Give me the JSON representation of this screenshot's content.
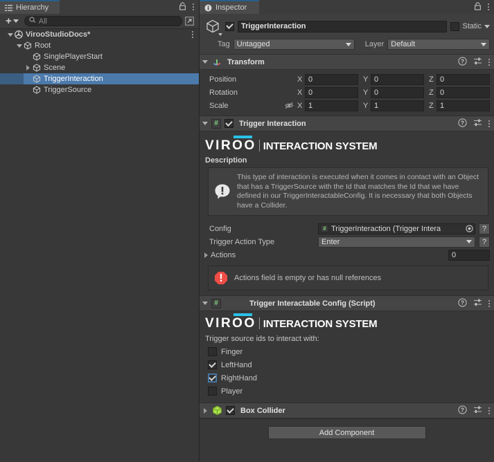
{
  "hierarchy": {
    "tab_label": "Hierarchy",
    "tab_icon": "hierarchy-list-icon",
    "lock_icon": "lock-icon",
    "menu_icon": "kebab-menu-icon",
    "toolbar": {
      "add_label": "+",
      "add_icon": "plus-icon",
      "dropdown_icon": "chevron-down-icon",
      "search_icon": "search-icon",
      "search_placeholder": "All",
      "search_value": "",
      "expand_icon": "open-in-new-icon"
    },
    "items": [
      {
        "label": "VirooStudioDocs*",
        "depth": 0,
        "foldout": "open",
        "icon": "unity-scene-icon",
        "selected": false,
        "bold": true,
        "kebab": true
      },
      {
        "label": "Root",
        "depth": 1,
        "foldout": "open",
        "icon": "gameobject-cube-icon",
        "selected": false,
        "bold": false,
        "kebab": false
      },
      {
        "label": "SinglePlayerStart",
        "depth": 2,
        "foldout": "none",
        "icon": "gameobject-cube-icon",
        "selected": false,
        "bold": false,
        "kebab": false
      },
      {
        "label": "Scene",
        "depth": 2,
        "foldout": "closed",
        "icon": "gameobject-cube-icon",
        "selected": false,
        "bold": false,
        "kebab": false
      },
      {
        "label": "TriggerInteraction",
        "depth": 2,
        "foldout": "none",
        "icon": "gameobject-cube-icon",
        "selected": true,
        "bold": false,
        "kebab": false
      },
      {
        "label": "TriggerSource",
        "depth": 2,
        "foldout": "none",
        "icon": "gameobject-cube-icon",
        "selected": false,
        "bold": false,
        "kebab": false
      }
    ]
  },
  "inspector": {
    "tab_label": "Inspector",
    "tab_icon": "info-circle-icon",
    "lock_icon": "lock-icon",
    "menu_icon": "kebab-menu-icon",
    "gameobject": {
      "icon": "gameobject-cube-icon",
      "enabled": true,
      "name": "TriggerInteraction",
      "static_label": "Static",
      "static_checked": false,
      "tag_label": "Tag",
      "tag_value": "Untagged",
      "layer_label": "Layer",
      "layer_value": "Default"
    },
    "components": [
      {
        "id": "transform",
        "title": "Transform",
        "icon": "transform-axis-icon",
        "expanded": true,
        "has_checkbox": false,
        "help_icon": "help-circle-icon",
        "preset_icon": "preset-sliders-icon",
        "menu_icon": "kebab-menu-icon",
        "rows": [
          {
            "label": "Position",
            "x": "0",
            "y": "0",
            "z": "0",
            "eye_off": false
          },
          {
            "label": "Rotation",
            "x": "0",
            "y": "0",
            "z": "0",
            "eye_off": false
          },
          {
            "label": "Scale",
            "x": "1",
            "y": "1",
            "z": "1",
            "eye_off": true,
            "eye_icon": "eye-off-icon"
          }
        ],
        "axis_labels": {
          "x": "X",
          "y": "Y",
          "z": "Z"
        }
      },
      {
        "id": "trigger-interaction",
        "title": "Trigger Interaction",
        "icon": "script-hash-icon",
        "expanded": true,
        "has_checkbox": true,
        "checked": true,
        "help_icon": "help-circle-icon",
        "preset_icon": "preset-sliders-icon",
        "menu_icon": "kebab-menu-icon",
        "brand": {
          "word": "VIROO",
          "tagline": "INTERACTION SYSTEM",
          "accent_color": "#29c2e8"
        },
        "description_label": "Description",
        "description_icon": "exclamation-bubble-icon",
        "description_text": "This type of interaction is executed when it comes in contact with an Object that has a TriggerSource with the Id that matches the Id that we have defined in our TriggerInteractableConfig. It is necessary that both Objects have a Collider.",
        "config_label": "Config",
        "config_value": "TriggerInteraction (Trigger Intera",
        "config_object_icon": "script-hash-icon",
        "config_picker_icon": "object-picker-icon",
        "config_help": "?",
        "action_type_label": "Trigger Action Type",
        "action_type_value": "Enter",
        "action_type_help": "?",
        "actions_label": "Actions",
        "actions_foldout": "closed",
        "actions_count": "0",
        "error_icon": "error-octagon-icon",
        "error_text": "Actions field is empty or has null references",
        "error_color": "#e8514a"
      },
      {
        "id": "trigger-interactable-config",
        "title": "Trigger Interactable Config (Script)",
        "icon": "script-hash-icon",
        "expanded": true,
        "has_checkbox": false,
        "help_icon": "help-circle-icon",
        "preset_icon": "preset-sliders-icon",
        "menu_icon": "kebab-menu-icon",
        "brand": {
          "word": "VIROO",
          "tagline": "INTERACTION SYSTEM",
          "accent_color": "#29c2e8"
        },
        "sources_label": "Trigger source ids to interact with:",
        "sources": [
          {
            "label": "Finger",
            "checked": false,
            "focused": false
          },
          {
            "label": "LeftHand",
            "checked": true,
            "focused": false
          },
          {
            "label": "RightHand",
            "checked": true,
            "focused": true
          },
          {
            "label": "Player",
            "checked": false,
            "focused": false
          }
        ]
      },
      {
        "id": "box-collider",
        "title": "Box Collider",
        "icon": "box-collider-icon",
        "expanded": false,
        "has_checkbox": true,
        "checked": true,
        "help_icon": "help-circle-icon",
        "preset_icon": "preset-sliders-icon",
        "menu_icon": "kebab-menu-icon"
      }
    ],
    "add_component_label": "Add Component"
  }
}
